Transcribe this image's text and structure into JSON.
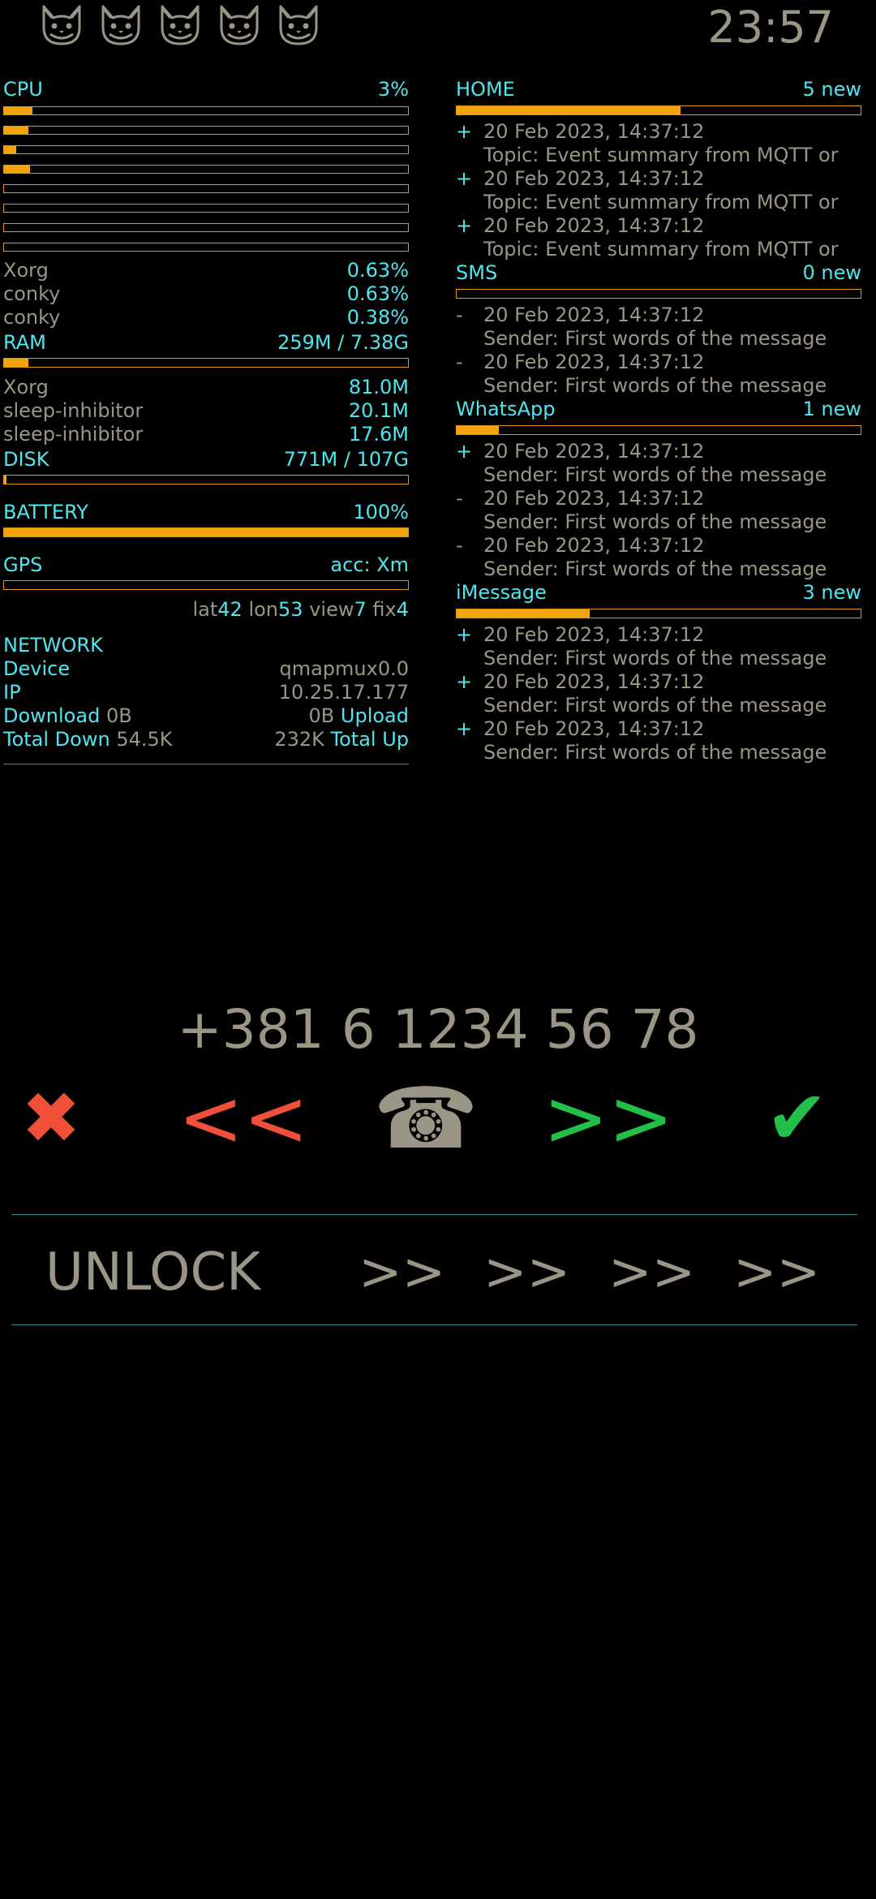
{
  "top": {
    "cats": [
      "cat-icon",
      "cat-icon",
      "cat-icon",
      "cat-icon",
      "cat-icon"
    ],
    "clock": "23:57"
  },
  "cpu": {
    "label": "CPU",
    "value": "3%",
    "cores": [
      0.07,
      0.06,
      0.03,
      0.065,
      0.0,
      0.0,
      0.0,
      0.0
    ],
    "procs": [
      {
        "name": "Xorg",
        "value": "0.63%"
      },
      {
        "name": "conky",
        "value": "0.63%"
      },
      {
        "name": "conky",
        "value": "0.38%"
      }
    ]
  },
  "ram": {
    "label": "RAM",
    "value": "259M / 7.38G",
    "fill": 0.06,
    "procs": [
      {
        "name": "Xorg",
        "value": "81.0M"
      },
      {
        "name": "sleep-inhibitor",
        "value": "20.1M"
      },
      {
        "name": "sleep-inhibitor",
        "value": "17.6M"
      }
    ]
  },
  "disk": {
    "label": "DISK",
    "value": "771M / 107G",
    "fill": 0.007
  },
  "battery": {
    "label": "BATTERY",
    "value": "100%",
    "fill": 1.0
  },
  "gps": {
    "label": "GPS",
    "value": "acc: Xm",
    "fill": 0.0,
    "lat_label": "lat",
    "lat": "42",
    "lon_label": "lon",
    "lon": "53",
    "view_label": "view",
    "view": "7",
    "fix_label": "fix",
    "fix": "4"
  },
  "network": {
    "label": "NETWORK",
    "device_label": "Device",
    "device": "qmapmux0.0",
    "ip_label": "IP",
    "ip": "10.25.17.177",
    "download_label": "Download",
    "download": "0B",
    "upload_label": "Upload",
    "upload": "0B",
    "total_down_label": "Total Down",
    "total_down": "54.5K",
    "total_up_label": "Total Up",
    "total_up": "232K"
  },
  "messages": [
    {
      "name": "HOME",
      "count": "5 new",
      "fill": 0.555,
      "items": [
        {
          "sign": "+",
          "date": "20 Feb 2023, 14:37:12",
          "text": "Topic: Event summary from MQTT or"
        },
        {
          "sign": "+",
          "date": "20 Feb 2023, 14:37:12",
          "text": "Topic: Event summary from MQTT or"
        },
        {
          "sign": "+",
          "date": "20 Feb 2023, 14:37:12",
          "text": "Topic: Event summary from MQTT or"
        }
      ]
    },
    {
      "name": "SMS",
      "count": "0 new",
      "fill": 0.0,
      "items": [
        {
          "sign": "-",
          "date": "20 Feb 2023, 14:37:12",
          "text": "Sender: First words of the message"
        },
        {
          "sign": "-",
          "date": "20 Feb 2023, 14:37:12",
          "text": "Sender: First words of the message"
        }
      ]
    },
    {
      "name": "WhatsApp",
      "count": "1 new",
      "fill": 0.105,
      "items": [
        {
          "sign": "+",
          "date": "20 Feb 2023, 14:37:12",
          "text": "Sender: First words of the message"
        },
        {
          "sign": "-",
          "date": "20 Feb 2023, 14:37:12",
          "text": "Sender: First words of the message"
        },
        {
          "sign": "-",
          "date": "20 Feb 2023, 14:37:12",
          "text": "Sender: First words of the message"
        }
      ]
    },
    {
      "name": "iMessage",
      "count": "3 new",
      "fill": 0.33,
      "items": [
        {
          "sign": "+",
          "date": "20 Feb 2023, 14:37:12",
          "text": "Sender: First words of the message"
        },
        {
          "sign": "+",
          "date": "20 Feb 2023, 14:37:12",
          "text": "Sender: First words of the message"
        },
        {
          "sign": "+",
          "date": "20 Feb 2023, 14:37:12",
          "text": "Sender: First words of the message"
        }
      ]
    }
  ],
  "dialer": {
    "number": "+381 6 1234 56 78",
    "reject": "✖",
    "prev": "<<",
    "phone": "☎",
    "next": ">>",
    "accept": "✔"
  },
  "unlock": {
    "label": "UNLOCK",
    "arrows": [
      ">>",
      ">>",
      ">>",
      ">>"
    ]
  },
  "colors": {
    "accent": "#f2a40e",
    "label": "#4fe6ee",
    "text": "#9a9585",
    "reject": "#f0503a",
    "accept": "#22c04a",
    "divider": "#2f8a93"
  }
}
